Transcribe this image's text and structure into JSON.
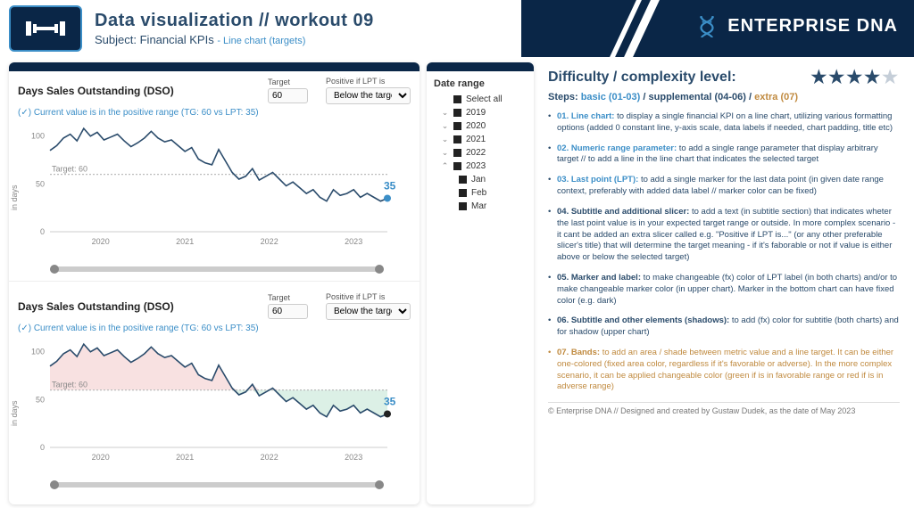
{
  "header": {
    "title": "Data visualization // workout 09",
    "subject_label": "Subject:",
    "subject": "Financial KPIs",
    "tag": "- Line chart (targets)",
    "brand_a": "ENTERPRISE",
    "brand_b": "DNA"
  },
  "chart1": {
    "title": "Days Sales Outstanding (DSO)",
    "target_label": "Target",
    "target_value": "60",
    "pos_label": "Positive if LPT is",
    "pos_value": "Below the target",
    "subtitle": "(✓) Current value is in the positive range (TG: 60 vs LPT: 35)",
    "y_label": "in days",
    "target_line_label": "Target: 60",
    "lpt_value": "35"
  },
  "chart2": {
    "title": "Days Sales Outstanding (DSO)",
    "target_label": "Target",
    "target_value": "60",
    "pos_label": "Positive if LPT is",
    "pos_value": "Below the target",
    "subtitle": "(✓) Current value is in the positive range (TG: 60 vs LPT: 35)",
    "y_label": "in days",
    "target_line_label": "Target: 60",
    "lpt_value": "35"
  },
  "slicer": {
    "title": "Date range",
    "select_all": "Select all",
    "years": [
      "2019",
      "2020",
      "2021",
      "2022",
      "2023"
    ],
    "months": [
      "Jan",
      "Feb",
      "Mar"
    ]
  },
  "info": {
    "difficulty_label": "Difficulty / complexity level:",
    "stars": 4,
    "steps_label": "Steps:",
    "steps_basic": "basic (01-03)",
    "steps_supp": "supplemental (04-06)",
    "steps_extra": "extra (07)",
    "b01_t": "01. Line chart:",
    "b01": "to display a single financial KPI on a line chart, utilizing various formatting options (added 0 constant line, y-axis scale, data labels if needed, chart padding, title etc)",
    "b02_t": "02. Numeric range parameter:",
    "b02": "to add a single range parameter that display arbitrary target // to add a line in the line chart that indicates the selected target",
    "b03_t": "03. Last point (LPT):",
    "b03": "to add a single marker for the last data point (in given date range context, preferably with added data label // marker color can be fixed)",
    "b04_t": "04. Subtitle and additional slicer:",
    "b04": "to add a text (in subtitle section) that indicates wheter the last point value is in your expected target range or outside. In more complex scenario - it cant be added an extra slicer called e.g. \"Positive if LPT is...\" (or any other preferable slicer's title) that will determine the target meaning - if it's faborable or not if value is either above or below the selected target)",
    "b05_t": "05. Marker and label:",
    "b05": "to make changeable (fx) color of LPT label (in both charts) and/or to make changeable marker color (in upper chart). Marker in the bottom chart can have fixed color (e.g. dark)",
    "b06_t": "06. Subtitle and other elements (shadows):",
    "b06": "to add (fx) color for subtitle (both charts) and for shadow (upper chart)",
    "b07_t": "07. Bands:",
    "b07": "to add an area / shade between metric value and a line target. It can be either one-colored (fixed area color, regardless if it's favorable or adverse). In the more complex scenario, it can be applied changeable color (green if is in favorable range or red if is in adverse range)",
    "footer": "© Enterprise DNA // Designed and created by Gustaw Dudek, as the date of May 2023"
  },
  "chart_data": [
    {
      "type": "line",
      "title": "Days Sales Outstanding (DSO)",
      "ylabel": "in days",
      "ylim": [
        0,
        110
      ],
      "yticks": [
        0,
        50,
        100
      ],
      "target": 60,
      "xticks": [
        "2020",
        "2021",
        "2022",
        "2023"
      ],
      "lpt": 35,
      "values": [
        85,
        90,
        98,
        102,
        95,
        108,
        100,
        104,
        96,
        99,
        102,
        95,
        89,
        93,
        98,
        105,
        98,
        94,
        96,
        90,
        84,
        88,
        76,
        72,
        70,
        86,
        74,
        62,
        55,
        58,
        66,
        54,
        58,
        62,
        55,
        48,
        52,
        46,
        40,
        44,
        36,
        32,
        44,
        38,
        40,
        44,
        36,
        40,
        36,
        32,
        35
      ]
    },
    {
      "type": "line",
      "title": "Days Sales Outstanding (DSO)",
      "ylabel": "in days",
      "ylim": [
        0,
        110
      ],
      "yticks": [
        0,
        50,
        100
      ],
      "target": 60,
      "xticks": [
        "2020",
        "2021",
        "2022",
        "2023"
      ],
      "lpt": 35,
      "bands": true,
      "values": [
        85,
        90,
        98,
        102,
        95,
        108,
        100,
        104,
        96,
        99,
        102,
        95,
        89,
        93,
        98,
        105,
        98,
        94,
        96,
        90,
        84,
        88,
        76,
        72,
        70,
        86,
        74,
        62,
        55,
        58,
        66,
        54,
        58,
        62,
        55,
        48,
        52,
        46,
        40,
        44,
        36,
        32,
        44,
        38,
        40,
        44,
        36,
        40,
        36,
        32,
        35
      ]
    }
  ]
}
